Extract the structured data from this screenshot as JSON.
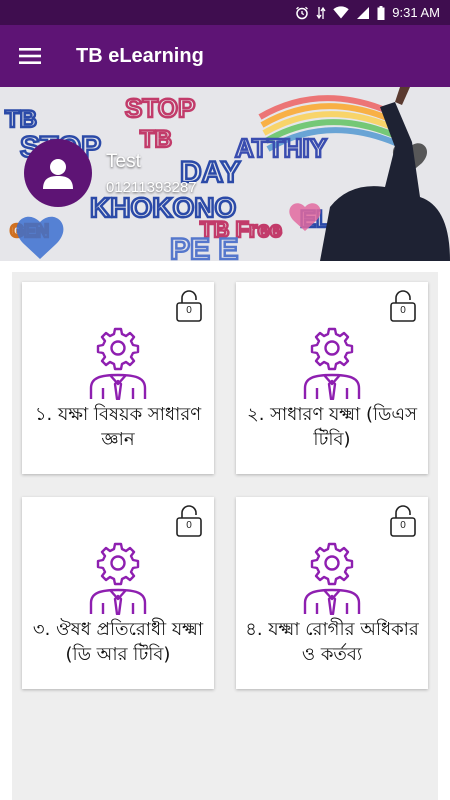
{
  "status_bar": {
    "time": "9:31 AM"
  },
  "app_bar": {
    "title": "TB eLearning",
    "menu_icon": "hamburger-menu-icon"
  },
  "profile": {
    "name": "Test",
    "phone": "01211393287"
  },
  "colors": {
    "primary": "#5e1475",
    "status_bar": "#3f0d4f",
    "accent": "#7b1fa2",
    "content_bg": "#eeeeee"
  },
  "modules": [
    {
      "title": "১. যক্ষা বিষয়ক সাধারণ জ্ঞান",
      "lock_count": "0"
    },
    {
      "title": "২. সাধারণ যক্ষ্মা (ডিএস টিবি)",
      "lock_count": "0"
    },
    {
      "title": "৩. ঔষধ প্রতিরোধী যক্ষ্মা (ডি আর টিবি)",
      "lock_count": "0"
    },
    {
      "title": "৪. যক্ষ্মা রোগীর অধিকার ও কর্তব্য",
      "lock_count": "0"
    }
  ]
}
